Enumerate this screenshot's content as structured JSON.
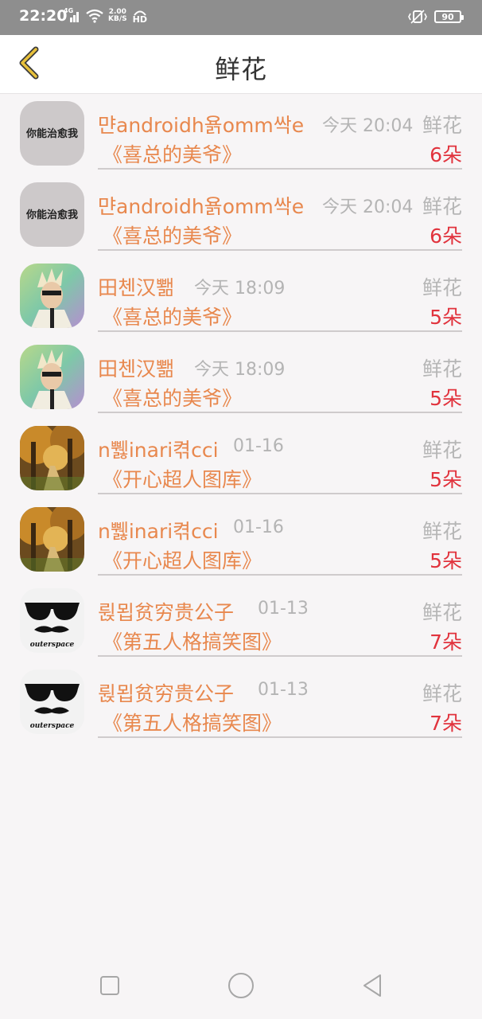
{
  "status_bar": {
    "time": "22:20",
    "network": "4G",
    "speed_value": "2.00",
    "speed_unit": "KB/S",
    "hd": "HD",
    "battery": "90"
  },
  "header": {
    "title": "鲜花",
    "back_icon": "chevron-left-icon",
    "accent": "#e8c13b"
  },
  "items": [
    {
      "name": "먄androidh욝omm싹e",
      "time": "今天 20:04",
      "type": "鲜花",
      "album": "《喜总的美爷》",
      "count": "6朵",
      "avatar_text": "你能治愈我",
      "avatar_kind": "text"
    },
    {
      "name": "먄androidh욝omm싹e",
      "time": "今天 20:04",
      "type": "鲜花",
      "album": "《喜总的美爷》",
      "count": "6朵",
      "avatar_text": "你能治愈我",
      "avatar_kind": "text"
    },
    {
      "name": "田첸汉뾂",
      "time": "今天 18:09",
      "type": "鲜花",
      "album": "《喜总的美爷》",
      "count": "5朵",
      "avatar_kind": "portrait"
    },
    {
      "name": "田첸汉뾂",
      "time": "今天 18:09",
      "type": "鲜花",
      "album": "《喜总的美爷》",
      "count": "5朵",
      "avatar_kind": "portrait"
    },
    {
      "name": "n쀓inari켞cci",
      "time": "01-16",
      "type": "鲜花",
      "album": "《开心超人图库》",
      "count": "5朵",
      "avatar_kind": "forest"
    },
    {
      "name": "n쀓inari켞cci",
      "time": "01-16",
      "type": "鲜花",
      "album": "《开心超人图库》",
      "count": "5朵",
      "avatar_kind": "forest"
    },
    {
      "name": "륁묍贫穷贵公子",
      "time": "01-13",
      "type": "鲜花",
      "album": "《第五人格搞笑图》",
      "count": "7朵",
      "avatar_text": "outerspace",
      "avatar_kind": "glasses"
    },
    {
      "name": "륁묍贫穷贵公子",
      "time": "01-13",
      "type": "鲜花",
      "album": "《第五人格搞笑图》",
      "count": "7朵",
      "avatar_text": "outerspace",
      "avatar_kind": "glasses"
    }
  ],
  "colors": {
    "name": "#e8884e",
    "time": "#b4b4b4",
    "count": "#e1333d",
    "divider": "#cfcbcc"
  },
  "nav": {
    "recent": "square-icon",
    "home": "circle-icon",
    "back": "triangle-back-icon"
  }
}
